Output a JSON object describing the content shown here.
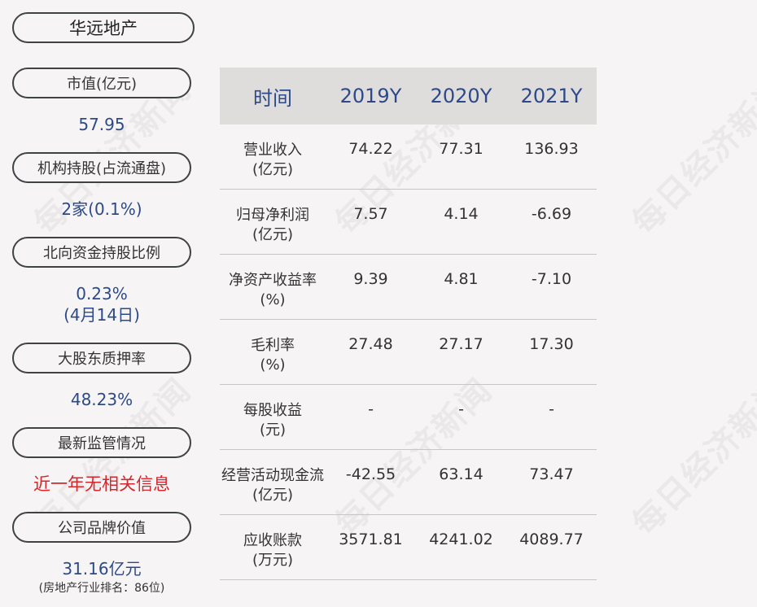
{
  "company": "华远地产",
  "left": {
    "market_cap_label": "市值(亿元)",
    "market_cap_value": "57.95",
    "institution_label": "机构持股(占流通盘)",
    "institution_value": "2家(0.1%)",
    "northbound_label": "北向资金持股比例",
    "northbound_value": "0.23%",
    "northbound_date": "(4月14日)",
    "pledge_label": "大股东质押率",
    "pledge_value": "48.23%",
    "regulation_label": "最新监管情况",
    "regulation_value": "近一年无相关信息",
    "brand_label": "公司品牌价值",
    "brand_value": "31.16亿元",
    "brand_rank_note": "(房地产行业排名：86位)"
  },
  "table": {
    "headers": [
      "时间",
      "2019Y",
      "2020Y",
      "2021Y"
    ],
    "rows": [
      {
        "name": "营业收入",
        "unit": "(亿元)",
        "values": [
          "74.22",
          "77.31",
          "136.93"
        ]
      },
      {
        "name": "归母净利润",
        "unit": "(亿元)",
        "values": [
          "7.57",
          "4.14",
          "-6.69"
        ]
      },
      {
        "name": "净资产收益率",
        "unit": "(%)",
        "values": [
          "9.39",
          "4.81",
          "-7.10"
        ]
      },
      {
        "name": "毛利率",
        "unit": "(%)",
        "values": [
          "27.48",
          "27.17",
          "17.30"
        ]
      },
      {
        "name": "每股收益",
        "unit": "(元)",
        "values": [
          "-",
          "-",
          "-"
        ]
      },
      {
        "name": "经营活动现金流",
        "unit": "(亿元)",
        "values": [
          "-42.55",
          "63.14",
          "73.47"
        ]
      },
      {
        "name": "应收账款",
        "unit": "(万元)",
        "values": [
          "3571.81",
          "4241.02",
          "4089.77"
        ]
      }
    ]
  },
  "watermark": "每日经济新闻"
}
